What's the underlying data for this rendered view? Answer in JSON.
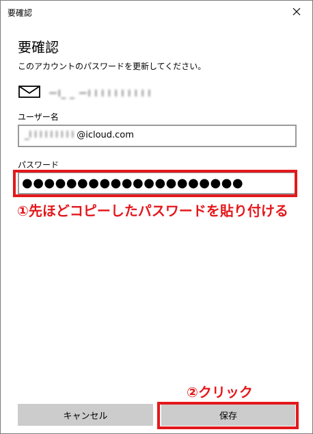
{
  "window": {
    "title": "要確認",
    "close_icon": "close-icon"
  },
  "dialog": {
    "heading": "要確認",
    "instruction": "このアカウントのパスワードを更新してください。",
    "account_email": "ーl_ _ ーl l l l l l l l l l",
    "account_icon": "mail-envelope-icon"
  },
  "username": {
    "label": "ユーザー名",
    "value_obscured": "_l l l l l l l l l ",
    "value_domain": "@icloud.com"
  },
  "password": {
    "label": "パスワード",
    "masked_value": "●●●●●●●●●●●●●●●●●●●●"
  },
  "annotations": {
    "step1": "①先ほどコピーしたパスワードを貼り付ける",
    "step2": "②クリック",
    "color": "#e3181c"
  },
  "buttons": {
    "cancel": "キャンセル",
    "save": "保存"
  }
}
